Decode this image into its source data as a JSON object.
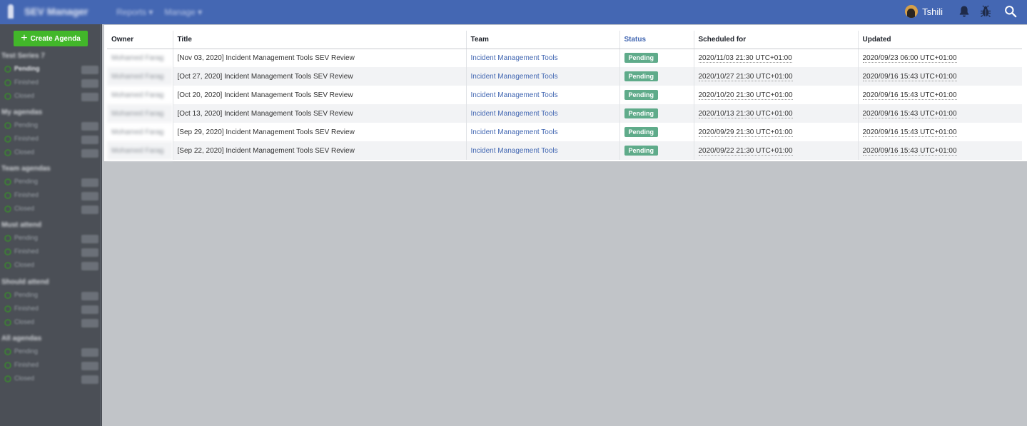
{
  "header": {
    "app_name": "SEV Manager",
    "nav": [
      "Reports ▾",
      "Manage ▾"
    ],
    "username": "Tshili"
  },
  "sidebar": {
    "create_label": "Create Agenda",
    "groups": [
      {
        "title": "Test Series 7",
        "items": [
          "Pending",
          "Finished",
          "Closed"
        ]
      },
      {
        "title": "My agendas",
        "items": [
          "Pending",
          "Finished",
          "Closed"
        ]
      },
      {
        "title": "Team agendas",
        "items": [
          "Pending",
          "Finished",
          "Closed"
        ]
      },
      {
        "title": "Must attend",
        "items": [
          "Pending",
          "Finished",
          "Closed"
        ]
      },
      {
        "title": "Should attend",
        "items": [
          "Pending",
          "Finished",
          "Closed"
        ]
      },
      {
        "title": "All agendas",
        "items": [
          "Pending",
          "Finished",
          "Closed"
        ]
      }
    ]
  },
  "table": {
    "headers": [
      "Owner",
      "Title",
      "Team",
      "Status",
      "Scheduled for",
      "Updated"
    ],
    "rows": [
      {
        "owner": "Mohamed Farag",
        "title": "[Nov 03, 2020] Incident Management Tools SEV Review",
        "team": "Incident Management Tools",
        "status": "Pending",
        "scheduled": "2020/11/03 21:30 UTC+01:00",
        "updated": "2020/09/23 06:00 UTC+01:00"
      },
      {
        "owner": "Mohamed Farag",
        "title": "[Oct 27, 2020] Incident Management Tools SEV Review",
        "team": "Incident Management Tools",
        "status": "Pending",
        "scheduled": "2020/10/27 21:30 UTC+01:00",
        "updated": "2020/09/16 15:43 UTC+01:00"
      },
      {
        "owner": "Mohamed Farag",
        "title": "[Oct 20, 2020] Incident Management Tools SEV Review",
        "team": "Incident Management Tools",
        "status": "Pending",
        "scheduled": "2020/10/20 21:30 UTC+01:00",
        "updated": "2020/09/16 15:43 UTC+01:00"
      },
      {
        "owner": "Mohamed Farag",
        "title": "[Oct 13, 2020] Incident Management Tools SEV Review",
        "team": "Incident Management Tools",
        "status": "Pending",
        "scheduled": "2020/10/13 21:30 UTC+01:00",
        "updated": "2020/09/16 15:43 UTC+01:00"
      },
      {
        "owner": "Mohamed Farag",
        "title": "[Sep 29, 2020] Incident Management Tools SEV Review",
        "team": "Incident Management Tools",
        "status": "Pending",
        "scheduled": "2020/09/29 21:30 UTC+01:00",
        "updated": "2020/09/16 15:43 UTC+01:00"
      },
      {
        "owner": "Mohamed Farag",
        "title": "[Sep 22, 2020] Incident Management Tools SEV Review",
        "team": "Incident Management Tools",
        "status": "Pending",
        "scheduled": "2020/09/22 21:30 UTC+01:00",
        "updated": "2020/09/16 15:43 UTC+01:00"
      }
    ]
  }
}
